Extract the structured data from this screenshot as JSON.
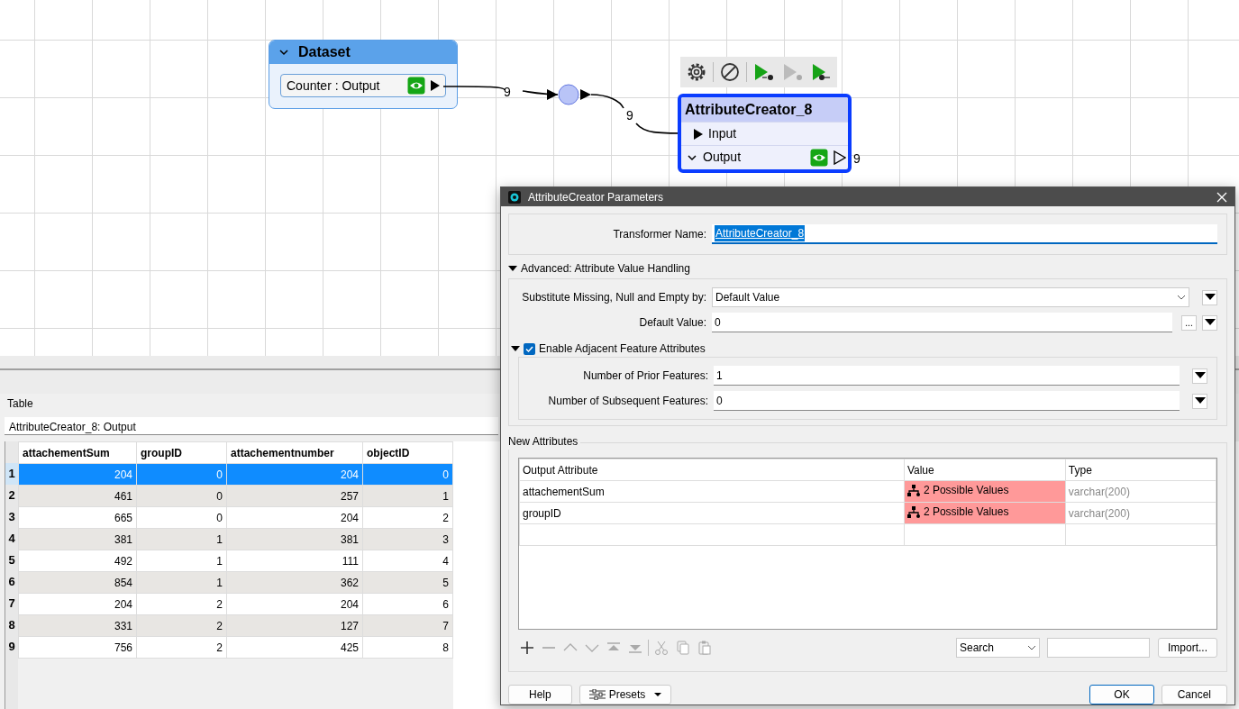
{
  "canvas": {
    "dataset": {
      "title": "Dataset",
      "expanded": true,
      "port": "Counter : Output",
      "inspect": true
    },
    "links": [
      {
        "count": "9"
      },
      {
        "count": "9"
      }
    ],
    "node_toolbar": [
      {
        "kind": "settings",
        "enabled": true
      },
      {
        "kind": "disable",
        "enabled": true
      },
      {
        "kind": "run-to",
        "enabled": true
      },
      {
        "kind": "run-this",
        "enabled": false
      },
      {
        "kind": "run-from",
        "enabled": true
      }
    ],
    "transformer": {
      "title": "AttributeCreator_8",
      "selected": true,
      "input": "Input",
      "output": "Output",
      "output_expanded": true,
      "inspect": true,
      "output_count": "9"
    }
  },
  "table_view": {
    "title": "Table",
    "source": "AttributeCreator_8: Output",
    "columns": [
      "attachementSum",
      "groupID",
      "attachementnumber",
      "objectID"
    ],
    "rows": [
      {
        "number": "1",
        "selected": true,
        "cells": [
          "204",
          "0",
          "204",
          "0"
        ]
      },
      {
        "number": "2",
        "selected": false,
        "cells": [
          "461",
          "0",
          "257",
          "1"
        ]
      },
      {
        "number": "3",
        "selected": false,
        "cells": [
          "665",
          "0",
          "204",
          "2"
        ]
      },
      {
        "number": "4",
        "selected": false,
        "cells": [
          "381",
          "1",
          "381",
          "3"
        ]
      },
      {
        "number": "5",
        "selected": false,
        "cells": [
          "492",
          "1",
          "111",
          "4"
        ]
      },
      {
        "number": "6",
        "selected": false,
        "cells": [
          "854",
          "1",
          "362",
          "5"
        ]
      },
      {
        "number": "7",
        "selected": false,
        "cells": [
          "204",
          "2",
          "204",
          "6"
        ]
      },
      {
        "number": "8",
        "selected": false,
        "cells": [
          "331",
          "2",
          "127",
          "7"
        ]
      },
      {
        "number": "9",
        "selected": false,
        "cells": [
          "756",
          "2",
          "425",
          "8"
        ]
      }
    ]
  },
  "dialog": {
    "title": "AttributeCreator Parameters",
    "transformer_name": {
      "label": "Transformer Name:",
      "value": "AttributeCreator_8",
      "selected": true
    },
    "advanced": {
      "title": "Advanced: Attribute Value Handling",
      "expanded": true,
      "substitute": {
        "label": "Substitute Missing, Null and Empty by:",
        "value": "Default Value"
      },
      "default_value": {
        "label": "Default Value:",
        "value": "0",
        "browse": "..."
      },
      "adjacent": {
        "title": "Enable Adjacent Feature Attributes",
        "expanded": true,
        "checked": true,
        "fields": [
          {
            "label": "Number of Prior Features:",
            "value": "1"
          },
          {
            "label": "Number of Subsequent Features:",
            "value": "0"
          }
        ]
      }
    },
    "new_attributes": {
      "title": "New Attributes",
      "columns": [
        "Output Attribute",
        "Value",
        "Type"
      ],
      "rows": [
        {
          "name": "attachementSum",
          "value": "2 Possible Values",
          "type": "varchar(200)",
          "conditional": true
        },
        {
          "name": "groupID",
          "value": "2 Possible Values",
          "type": "varchar(200)",
          "conditional": true
        }
      ],
      "search": "Search",
      "import": "Import..."
    },
    "buttons": [
      {
        "kind": "help",
        "label": "Help"
      },
      {
        "kind": "presets",
        "label": "Presets"
      },
      {
        "kind": "ok",
        "label": "OK"
      },
      {
        "kind": "cancel",
        "label": "Cancel"
      }
    ]
  }
}
